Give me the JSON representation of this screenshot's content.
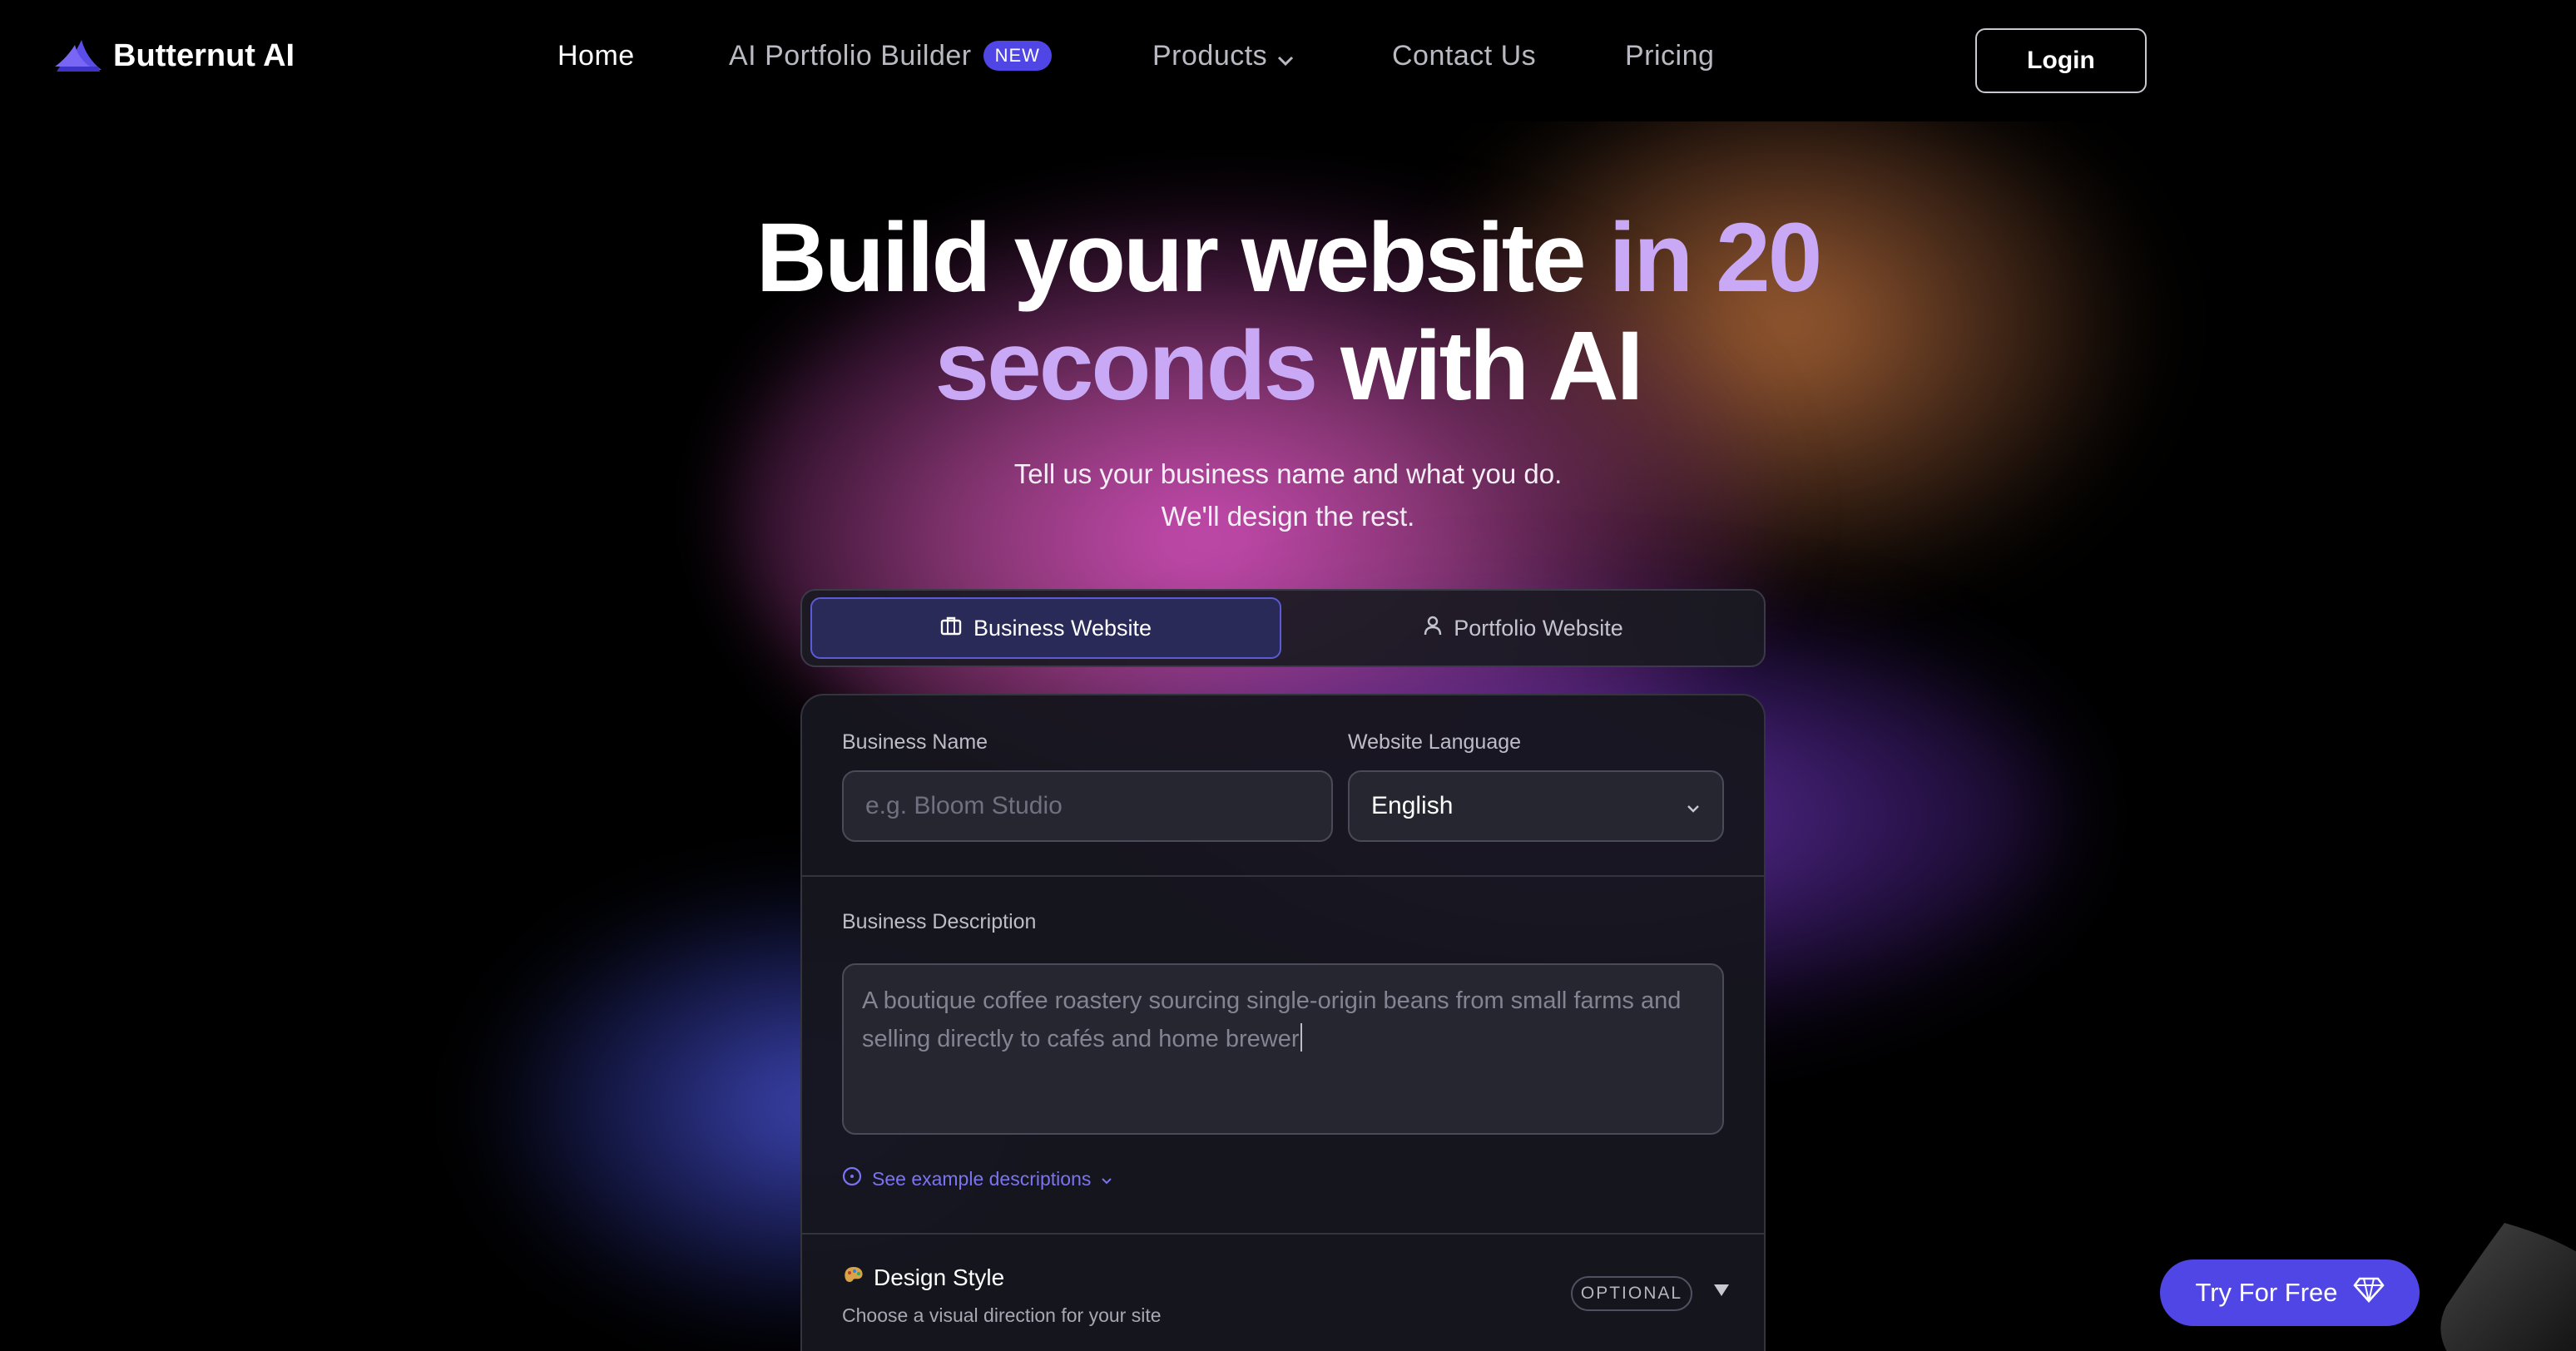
{
  "brand": {
    "name": "Butternut AI"
  },
  "nav": {
    "home": "Home",
    "portfolio_builder": "AI Portfolio Builder",
    "portfolio_badge": "NEW",
    "products": "Products",
    "contact": "Contact Us",
    "pricing": "Pricing",
    "login": "Login"
  },
  "hero": {
    "title_part1": "Build your website ",
    "title_highlight1": "in 20",
    "title_highlight2": "seconds",
    "title_part2": " with AI",
    "subtitle_line1": "Tell us your business name and what you do.",
    "subtitle_line2": "We'll design the rest."
  },
  "tabs": {
    "business": "Business Website",
    "portfolio": "Portfolio Website",
    "selected": "Business Website"
  },
  "form": {
    "business_name_label": "Business Name",
    "business_name_placeholder": "e.g. Bloom Studio",
    "language_label": "Website Language",
    "language_value": "English",
    "description_label": "Business Description",
    "description_placeholder": "A boutique coffee roastery sourcing single-origin beans from small farms and selling directly to cafés and home brewer",
    "example_link": "See example descriptions",
    "design_style_title": "Design Style",
    "design_style_desc": "Choose a visual direction for your site",
    "optional_badge": "OPTIONAL"
  },
  "cta": {
    "try_free": "Try For Free"
  },
  "colors": {
    "accent": "#4f46e5",
    "highlight_text": "#c9a9f5",
    "background": "#000000"
  },
  "icons": {
    "logo": "butternut-logo-icon",
    "products_chevron": "chevron-down-icon",
    "business_tab": "briefcase-icon",
    "portfolio_tab": "user-icon",
    "select_chevron": "chevron-down-icon",
    "info": "info-circle-icon",
    "design": "palette-icon",
    "expand": "triangle-down-icon",
    "try_free": "diamond-icon"
  }
}
